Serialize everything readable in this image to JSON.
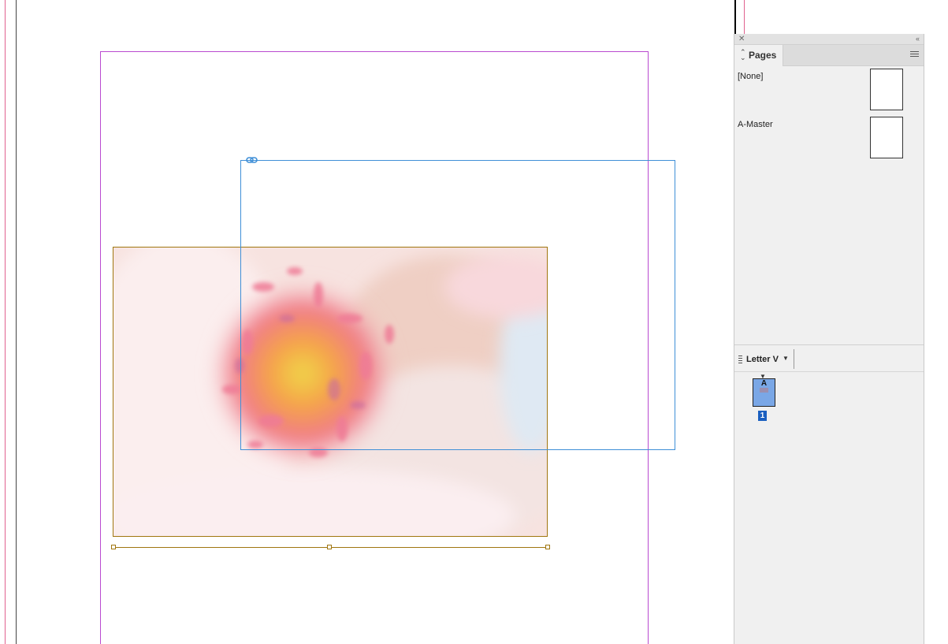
{
  "panel": {
    "close_glyph": "✕",
    "collapse_glyph": "‹‹",
    "tab_label": "Pages",
    "tab_arrows": "⌃⌄",
    "masters": [
      {
        "label": "[None]"
      },
      {
        "label": "A-Master"
      }
    ],
    "page_size_label": "Letter V",
    "page_size_caret": "▼",
    "pages": [
      {
        "number": "1",
        "master_letter": "A"
      }
    ]
  },
  "icons": {
    "link": "link-icon",
    "panel_menu": "hamburger-menu-icon",
    "close": "close-icon",
    "collapse": "collapse-panel-icon"
  },
  "colors": {
    "margin_guide": "#b94ad0",
    "bleed_guide": "#e0628f",
    "image_frame": "#a0760f",
    "text_frame": "#3f8fd7",
    "selected_page": "#1a5fc0"
  }
}
